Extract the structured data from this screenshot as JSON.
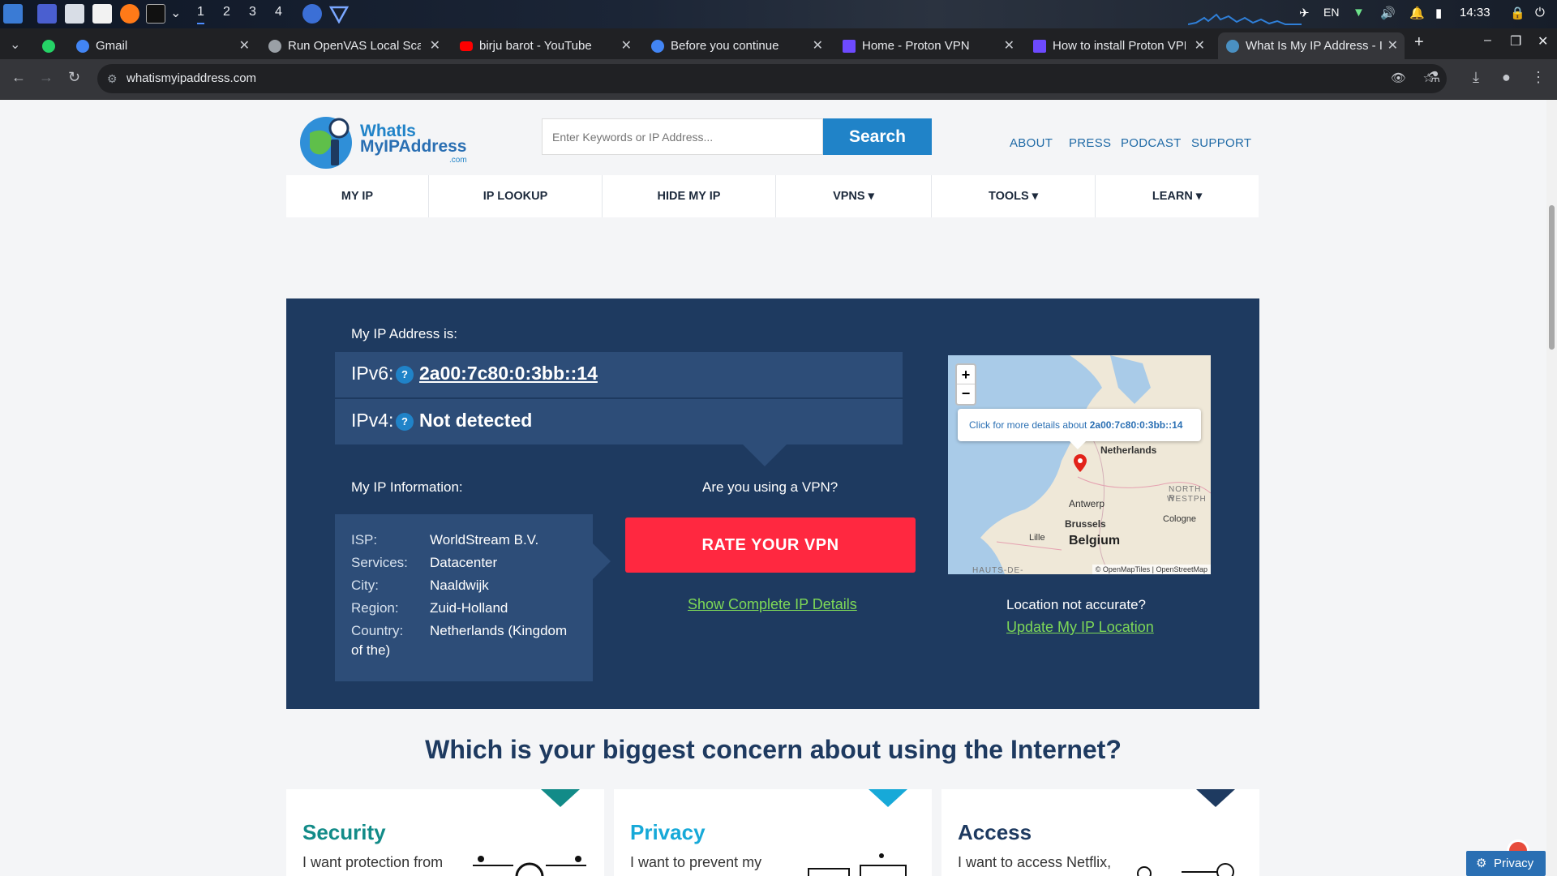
{
  "taskbar": {
    "workspaces": [
      "1",
      "2",
      "3",
      "4"
    ],
    "lang": "EN",
    "time": "14:33"
  },
  "tabs": [
    {
      "title": "Gmail",
      "color": "#ea4335"
    },
    {
      "title": "Run OpenVAS Local Scan",
      "color": "#9aa0a6"
    },
    {
      "title": "birju barot - YouTube",
      "color": "#ff0000"
    },
    {
      "title": "Before you continue",
      "color": "#4285f4"
    },
    {
      "title": "Home - Proton VPN",
      "color": "#6d4aff"
    },
    {
      "title": "How to install Proton VPN",
      "color": "#6d4aff"
    },
    {
      "title": "What Is My IP Address - IP",
      "color": "#4a90c2"
    }
  ],
  "address_bar": {
    "url": "whatismyipaddress.com"
  },
  "site": {
    "logo_line1": "WhatIs",
    "logo_line2": "MyIPAddress",
    "logo_line3": ".com",
    "search_placeholder": "Enter Keywords or IP Address...",
    "search_button": "Search",
    "top_links": [
      "ABOUT",
      "PRESS",
      "PODCAST",
      "SUPPORT"
    ],
    "nav": [
      "MY IP",
      "IP LOOKUP",
      "HIDE MY IP",
      "VPNS ▾",
      "TOOLS ▾",
      "LEARN ▾"
    ]
  },
  "hero": {
    "my_ip_heading": "My IP Address is:",
    "ipv6_label": "IPv6:",
    "ipv6_value": "2a00:7c80:0:3bb::14",
    "ipv4_label": "IPv4:",
    "ipv4_value": "Not detected",
    "q": "?",
    "info_heading": "My IP Information:",
    "vpn_question": "Are you using a VPN?",
    "info": [
      {
        "k": "ISP:",
        "v": "WorldStream B.V."
      },
      {
        "k": "Services:",
        "v": "Datacenter"
      },
      {
        "k": "City:",
        "v": "Naaldwijk"
      },
      {
        "k": "Region:",
        "v": "Zuid-Holland"
      },
      {
        "k": "Country:",
        "v": "Netherlands (Kingdom"
      },
      {
        "k": "of the)",
        "v": ""
      }
    ],
    "rate_button": "RATE YOUR VPN",
    "show_details": "Show Complete IP Details",
    "loc_question": "Location not accurate?",
    "update_location": "Update My IP Location"
  },
  "map": {
    "zoom_in": "+",
    "zoom_out": "−",
    "popup_prefix": "Click for more details about ",
    "popup_ip": "2a00:7c80:0:3bb::14",
    "labels": {
      "netherlands": "Netherlands",
      "antwerp": "Antwerp",
      "brussels": "Brussels",
      "belgium": "Belgium",
      "lille": "Lille",
      "cologne": "Cologne",
      "north": "NORTH R",
      "westph": "WESTPH",
      "hauts": "HAUTS-DE-"
    },
    "attribution": "© OpenMapTiles | OpenStreetMap"
  },
  "concern": {
    "title": "Which is your biggest concern about using the Internet?",
    "cards": [
      {
        "title": "Security",
        "text": "I want protection from",
        "color": "#128b88"
      },
      {
        "title": "Privacy",
        "text": "I want to prevent my",
        "color": "#17a9d8"
      },
      {
        "title": "Access",
        "text": "I want to access Netflix,",
        "color": "#1e3a60"
      }
    ]
  },
  "privacy_fab": "Privacy"
}
